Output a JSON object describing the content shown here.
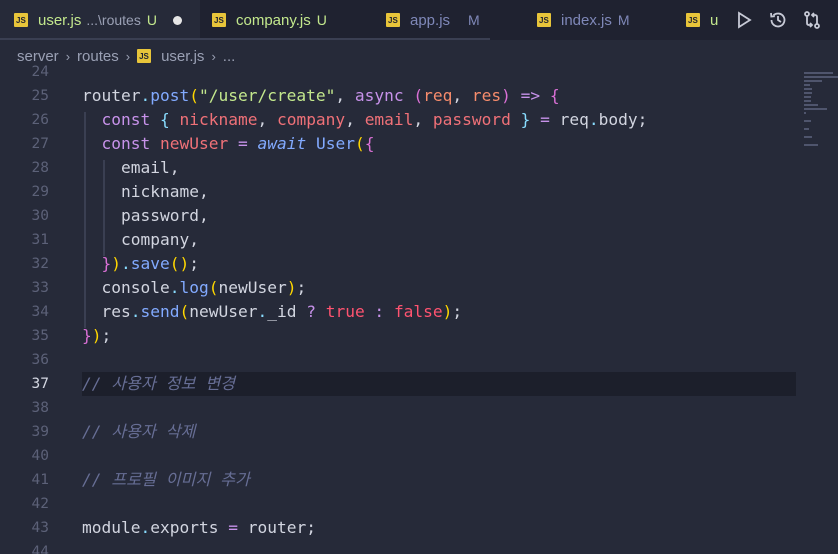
{
  "tabs": [
    {
      "name": "user.js",
      "desc": "...\\routes",
      "status": "U",
      "status_color": "#c3e88d",
      "name_color": "#c3e88d",
      "active": true,
      "modified_dot": true
    },
    {
      "name": "company.js",
      "status": "U",
      "status_color": "#c3e88d",
      "name_color": "#c3e88d"
    },
    {
      "name": "app.js",
      "status": "M",
      "status_color": "#7f88b8",
      "name_color": "#7f88b8"
    },
    {
      "name": "index.js",
      "status": "M",
      "status_color": "#7f88b8",
      "name_color": "#7f88b8"
    },
    {
      "name": "u",
      "status": "",
      "name_color": "#c3e88d"
    }
  ],
  "js_icon_text": "JS",
  "actions": [
    {
      "icon": "run-icon"
    },
    {
      "icon": "history-icon"
    },
    {
      "icon": "compare-changes-icon"
    }
  ],
  "breadcrumb": {
    "segments": [
      "server",
      "routes",
      "user.js",
      "..."
    ],
    "separator": "›"
  },
  "editor": {
    "active_line": 37,
    "lines": [
      {
        "num": 24,
        "tokens": []
      },
      {
        "num": 25,
        "tokens": [
          {
            "t": "router",
            "c": "id"
          },
          {
            "t": ".",
            "c": "punct"
          },
          {
            "t": "post",
            "c": "fn"
          },
          {
            "t": "(",
            "c": "brace1"
          },
          {
            "t": "\"/user/create\"",
            "c": "str"
          },
          {
            "t": ", ",
            "c": "id"
          },
          {
            "t": "async",
            "c": "kw"
          },
          {
            "t": " (",
            "c": "brace2"
          },
          {
            "t": "req",
            "c": "param"
          },
          {
            "t": ", ",
            "c": "id"
          },
          {
            "t": "res",
            "c": "param"
          },
          {
            "t": ") ",
            "c": "brace2"
          },
          {
            "t": "=>",
            "c": "kw"
          },
          {
            "t": " {",
            "c": "brace2"
          }
        ]
      },
      {
        "num": 26,
        "tokens": [
          {
            "t": "  ",
            "c": "id"
          },
          {
            "t": "const",
            "c": "kw"
          },
          {
            "t": " { ",
            "c": "punct"
          },
          {
            "t": "nickname",
            "c": "var"
          },
          {
            "t": ", ",
            "c": "id"
          },
          {
            "t": "company",
            "c": "var"
          },
          {
            "t": ", ",
            "c": "id"
          },
          {
            "t": "email",
            "c": "var"
          },
          {
            "t": ", ",
            "c": "id"
          },
          {
            "t": "password",
            "c": "var"
          },
          {
            "t": " } ",
            "c": "punct"
          },
          {
            "t": "= ",
            "c": "kw"
          },
          {
            "t": "req",
            "c": "id"
          },
          {
            "t": ".",
            "c": "punct"
          },
          {
            "t": "body",
            "c": "id"
          },
          {
            "t": ";",
            "c": "id"
          }
        ]
      },
      {
        "num": 27,
        "tokens": [
          {
            "t": "  ",
            "c": "id"
          },
          {
            "t": "const",
            "c": "kw"
          },
          {
            "t": " ",
            "c": "id"
          },
          {
            "t": "newUser",
            "c": "var"
          },
          {
            "t": " = ",
            "c": "kw"
          },
          {
            "t": "await",
            "c": "await"
          },
          {
            "t": " ",
            "c": "id"
          },
          {
            "t": "User",
            "c": "class"
          },
          {
            "t": "(",
            "c": "brace1"
          },
          {
            "t": "{",
            "c": "brace2"
          }
        ]
      },
      {
        "num": 28,
        "tokens": [
          {
            "t": "    email,",
            "c": "id"
          }
        ]
      },
      {
        "num": 29,
        "tokens": [
          {
            "t": "    nickname,",
            "c": "id"
          }
        ]
      },
      {
        "num": 30,
        "tokens": [
          {
            "t": "    password,",
            "c": "id"
          }
        ]
      },
      {
        "num": 31,
        "tokens": [
          {
            "t": "    company,",
            "c": "id"
          }
        ]
      },
      {
        "num": 32,
        "tokens": [
          {
            "t": "  ",
            "c": "id"
          },
          {
            "t": "}",
            "c": "brace2"
          },
          {
            "t": ")",
            "c": "brace1"
          },
          {
            "t": ".",
            "c": "punct"
          },
          {
            "t": "save",
            "c": "fn"
          },
          {
            "t": "()",
            "c": "brace1"
          },
          {
            "t": ";",
            "c": "id"
          }
        ]
      },
      {
        "num": 33,
        "tokens": [
          {
            "t": "  console",
            "c": "id"
          },
          {
            "t": ".",
            "c": "punct"
          },
          {
            "t": "log",
            "c": "fn"
          },
          {
            "t": "(",
            "c": "brace1"
          },
          {
            "t": "newUser",
            "c": "id"
          },
          {
            "t": ")",
            "c": "brace1"
          },
          {
            "t": ";",
            "c": "id"
          }
        ]
      },
      {
        "num": 34,
        "tokens": [
          {
            "t": "  res",
            "c": "id"
          },
          {
            "t": ".",
            "c": "punct"
          },
          {
            "t": "send",
            "c": "fn"
          },
          {
            "t": "(",
            "c": "brace1"
          },
          {
            "t": "newUser",
            "c": "id"
          },
          {
            "t": ".",
            "c": "punct"
          },
          {
            "t": "_id",
            "c": "id"
          },
          {
            "t": " ? ",
            "c": "kw"
          },
          {
            "t": "true",
            "c": "bool"
          },
          {
            "t": " : ",
            "c": "kw"
          },
          {
            "t": "false",
            "c": "bool"
          },
          {
            "t": ")",
            "c": "brace1"
          },
          {
            "t": ";",
            "c": "id"
          }
        ]
      },
      {
        "num": 35,
        "tokens": [
          {
            "t": "}",
            "c": "brace2"
          },
          {
            "t": ")",
            "c": "brace1"
          },
          {
            "t": ";",
            "c": "id"
          }
        ]
      },
      {
        "num": 36,
        "tokens": []
      },
      {
        "num": 37,
        "tokens": [
          {
            "t": "// 사용자 정보 변경",
            "c": "comment"
          }
        ]
      },
      {
        "num": 38,
        "tokens": []
      },
      {
        "num": 39,
        "tokens": [
          {
            "t": "// 사용자 삭제",
            "c": "comment"
          }
        ]
      },
      {
        "num": 40,
        "tokens": []
      },
      {
        "num": 41,
        "tokens": [
          {
            "t": "// 프로필 이미지 추가",
            "c": "comment"
          }
        ]
      },
      {
        "num": 42,
        "tokens": []
      },
      {
        "num": 43,
        "tokens": [
          {
            "t": "module",
            "c": "id"
          },
          {
            "t": ".",
            "c": "punct"
          },
          {
            "t": "exports",
            "c": "id"
          },
          {
            "t": " = ",
            "c": "kw"
          },
          {
            "t": "router",
            "c": "id"
          },
          {
            "t": ";",
            "c": "id"
          }
        ]
      },
      {
        "num": 44,
        "tokens": []
      }
    ]
  }
}
